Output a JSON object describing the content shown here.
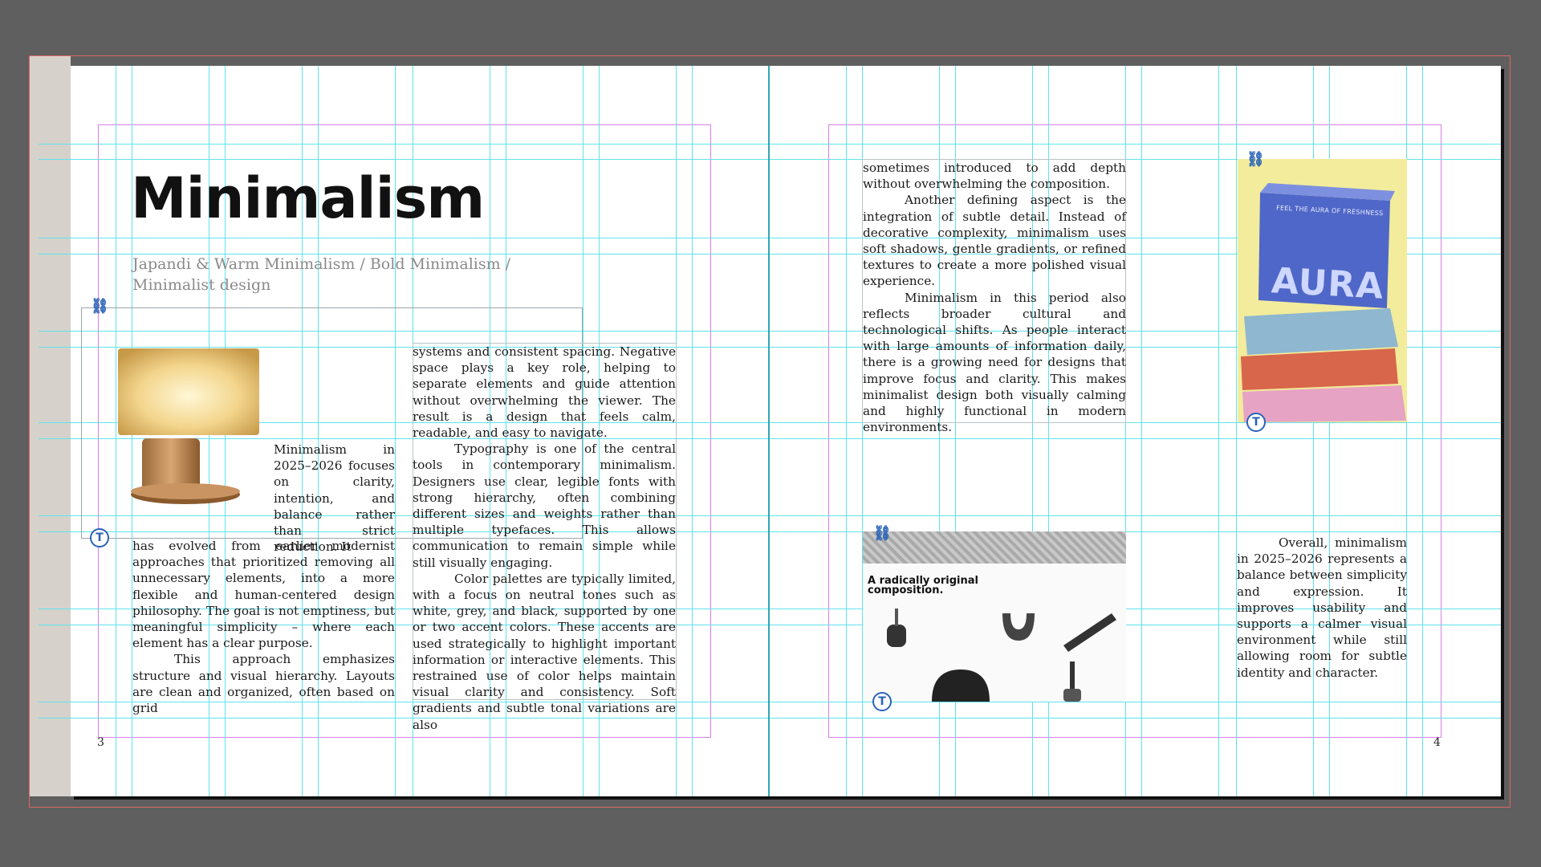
{
  "spread": {
    "left_page": {
      "page_number": "3",
      "title": "Minimalism",
      "subtitle": "Japandi & Warm Minimalism / Bold Minimalism / Minimalist design",
      "column1": {
        "wrap_text": "Minimalism in 2025–2026 focuses on clarity, intention, and balance rather than strict reduction. It",
        "para1_rest": "has evolved from earlier modernist approaches that prioritized removing all unnecessary elements, into a more flexible and human-centered design philosophy. The goal is not emptiness, but meaningful simplicity – where each element has a clear purpose.",
        "para2": "This approach emphasizes structure and visual hierarchy. Layouts are clean and organized, often based on grid"
      },
      "column2": {
        "para1": "systems and consistent spacing. Negative space plays a key role, helping to separate elements and guide attention without overwhelming the viewer. The result is a design that feels calm, readable, and easy to navigate.",
        "para2": "Typography is one of the central tools in contemporary minimalism. Designers use clear, legible fonts with strong hierarchy, often combining different sizes and weights rather than multiple typefaces. This allows communication to remain simple while still visually engaging.",
        "para3": "Color palettes are typically limited, with a focus on neutral tones such as white, grey, and black, supported by one or two accent colors. These accents are used strategically to highlight important information or interactive elements. This restrained use of color helps maintain visual clarity and consistency. Soft gradients and subtle tonal variations are also"
      }
    },
    "right_page": {
      "page_number": "4",
      "column1": {
        "para1": "sometimes introduced to add depth without overwhelming the composition.",
        "para2": "Another defining aspect is the integration of subtle detail. Instead of decorative complexity, minimalism uses soft shadows, gentle gradients, or refined textures to create a more polished visual experience.",
        "para3": "Minimalism in this period also reflects broader cultural and technological shifts. As people interact with large amounts of information daily, there is a growing need for designs that improve focus and clarity. This makes minimalist design both visually calming and highly functional in modern environments."
      },
      "column2": {
        "para1": "Overall, minimalism in 2025–2026 represents a balance between simplicity and expression. It improves usability and supports a calmer visual environment while still allowing room for subtle identity and character."
      },
      "poster_image": {
        "tagline": "FEEL THE AURA OF FRESHNESS",
        "brand": "AURA"
      },
      "composition_image": {
        "headline": "A radically original composition."
      }
    }
  },
  "icons": {
    "link": "link-icon",
    "text_frame": "text-frame-icon",
    "text_frame_glyph": "T",
    "link_glyph": "⛓"
  },
  "colors": {
    "pasteboard": "#5f5f5f",
    "guides": "#5fe3ec",
    "margins": "#d97ee6",
    "bleed": "#dd6666",
    "frame_icons": "#2a63b8",
    "poster_bg": "#f2ec9c"
  }
}
